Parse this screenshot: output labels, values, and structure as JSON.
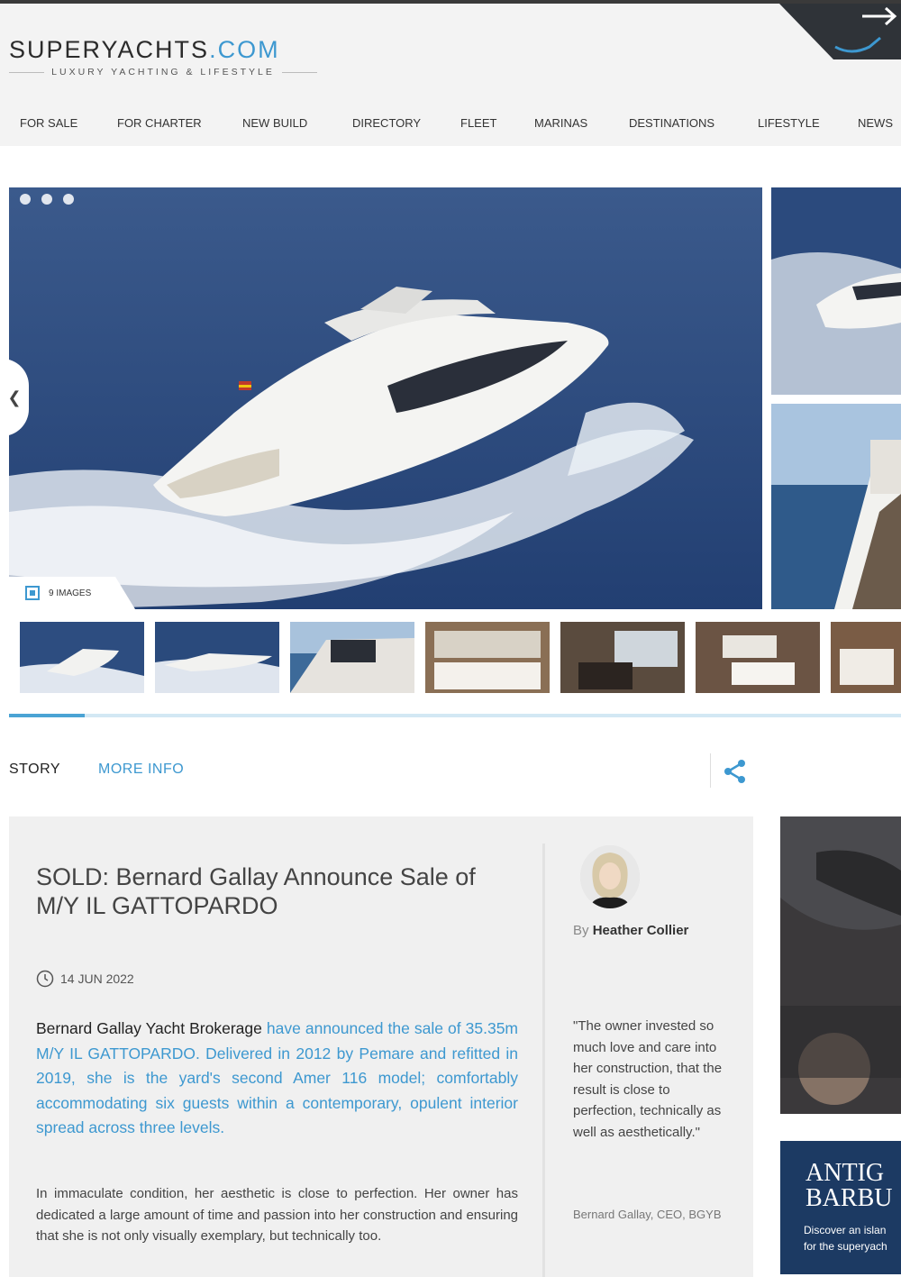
{
  "site": {
    "logo_main": "SUPERYACHTS",
    "logo_dot": ".COM",
    "tagline": "LUXURY YACHTING & LIFESTYLE"
  },
  "nav": [
    "FOR SALE",
    "FOR CHARTER",
    "NEW BUILD",
    "DIRECTORY",
    "FLEET",
    "MARINAS",
    "DESTINATIONS",
    "LIFESTYLE",
    "NEWS"
  ],
  "gallery": {
    "image_count": "9 IMAGES",
    "slide_dots": 3,
    "progress_fraction": 0.085
  },
  "tabs": {
    "story": "STORY",
    "more_info": "MORE INFO"
  },
  "article": {
    "title": "SOLD: Bernard Gallay Announce Sale of M/Y IL GATTOPARDO",
    "date": "14 JUN 2022",
    "lead_plain": "Bernard Gallay Yacht Brokerage ",
    "lead_highlight": "have announced the sale of 35.35m M/Y IL GATTOPARDO. Delivered in 2012 by Pemare and refitted in 2019, she is the yard's second Amer 116 model; comfortably accommodating six guests within a contemporary, opulent interior spread across three levels.",
    "body": "In immaculate condition, her aesthetic is close to perfection. Her owner has dedicated a large amount of time and passion into her construction and ensuring that she is not only visually exemplary, but technically too."
  },
  "author": {
    "by": "By ",
    "name": "Heather Collier"
  },
  "quote": {
    "text": "\"The owner invested so much love and care into her construction, that the result is close to perfection, technically as well as aesthetically.\"",
    "author": "Bernard Gallay, CEO, BGYB"
  },
  "ad2": {
    "brand_line1": "ANTIG",
    "brand_line2": "BARBU",
    "text_line1": "Discover an islan",
    "text_line2": "for the superyach"
  },
  "colors": {
    "accent": "#3d98d0",
    "header_bg": "#f3f3f3",
    "article_bg": "#f0f0f0"
  }
}
